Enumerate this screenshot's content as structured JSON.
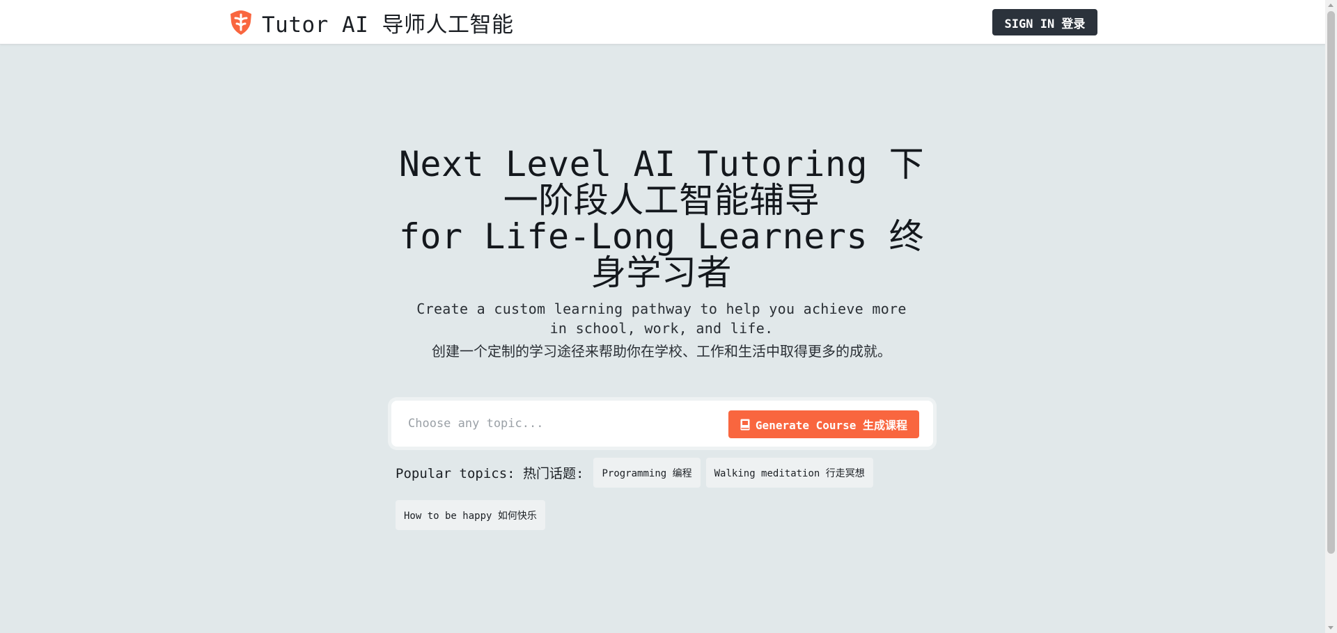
{
  "header": {
    "brand_name": "Tutor AI 导师人工智能",
    "logo_icon": "acorn-shield-icon",
    "signin_label": "SIGN IN 登录"
  },
  "hero": {
    "title_line1": "Next Level AI Tutoring 下一阶段人工智能辅导",
    "title_line2": "for Life-Long Learners 终身学习者",
    "subtitle": "Create a custom learning pathway to help you achieve more in school, work, and life.",
    "subtitle_cn": "创建一个定制的学习途径来帮助你在学校、工作和生活中取得更多的成就。"
  },
  "search": {
    "placeholder": "Choose any topic...",
    "value": "",
    "generate_label": "Generate Course 生成课程",
    "generate_icon": "book-icon"
  },
  "topics": {
    "label": "Popular topics: 热门话题:",
    "items": [
      {
        "label": "Programming 编程"
      },
      {
        "label": "Walking meditation 行走冥想"
      },
      {
        "label": "How to be happy 如何快乐"
      }
    ]
  },
  "colors": {
    "accent": "#f9663f",
    "dark_button": "#2b323b",
    "page_background": "#e1e8ea"
  }
}
